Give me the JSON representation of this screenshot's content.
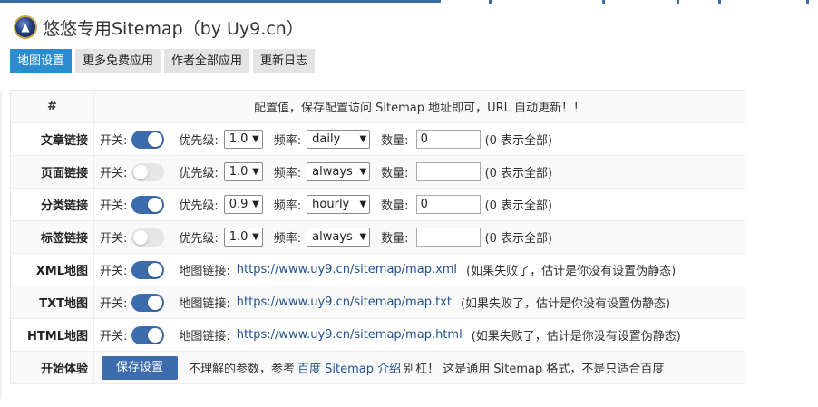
{
  "header": {
    "title": "悠悠专用Sitemap（by Uy9.cn）"
  },
  "tabs": [
    "地图设置",
    "更多免费应用",
    "作者全部应用",
    "更新日志"
  ],
  "table": {
    "hash": "#",
    "header_text": "配置值，保存配置访问 Sitemap 地址即可，URL 自动更新！！",
    "switch_label": "开关:",
    "priority_label": "优先级:",
    "freq_label": "频率:",
    "count_label": "数量:",
    "count_note": "(0 表示全部)",
    "map_link_label": "地图链接:",
    "map_note": "(如果失败了，估计是你没有设置伪静态)",
    "rows": [
      {
        "label": "文章链接",
        "switch": "on",
        "priority": "1.0",
        "freq": "daily",
        "count": "0"
      },
      {
        "label": "页面链接",
        "switch": "off",
        "priority": "1.0",
        "freq": "always",
        "count": ""
      },
      {
        "label": "分类链接",
        "switch": "on",
        "priority": "0.9",
        "freq": "hourly",
        "count": "0"
      },
      {
        "label": "标签链接",
        "switch": "off",
        "priority": "1.0",
        "freq": "always",
        "count": ""
      }
    ],
    "maps": [
      {
        "label": "XML地图",
        "switch": "on",
        "url": "https://www.uy9.cn/sitemap/map.xml"
      },
      {
        "label": "TXT地图",
        "switch": "on",
        "url": "https://www.uy9.cn/sitemap/map.txt"
      },
      {
        "label": "HTML地图",
        "switch": "on",
        "url": "https://www.uy9.cn/sitemap/map.html"
      }
    ],
    "start": {
      "label": "开始体验",
      "save_button": "保存设置",
      "text1": "不理解的参数，参考",
      "link": "百度 Sitemap 介绍",
      "text2": "别杠！ 这是通用 Sitemap 格式，不是只适合百度"
    }
  },
  "colors": {
    "accent": "#3c6cab",
    "tab_active": "#2a8dd0",
    "link": "#23528f"
  }
}
